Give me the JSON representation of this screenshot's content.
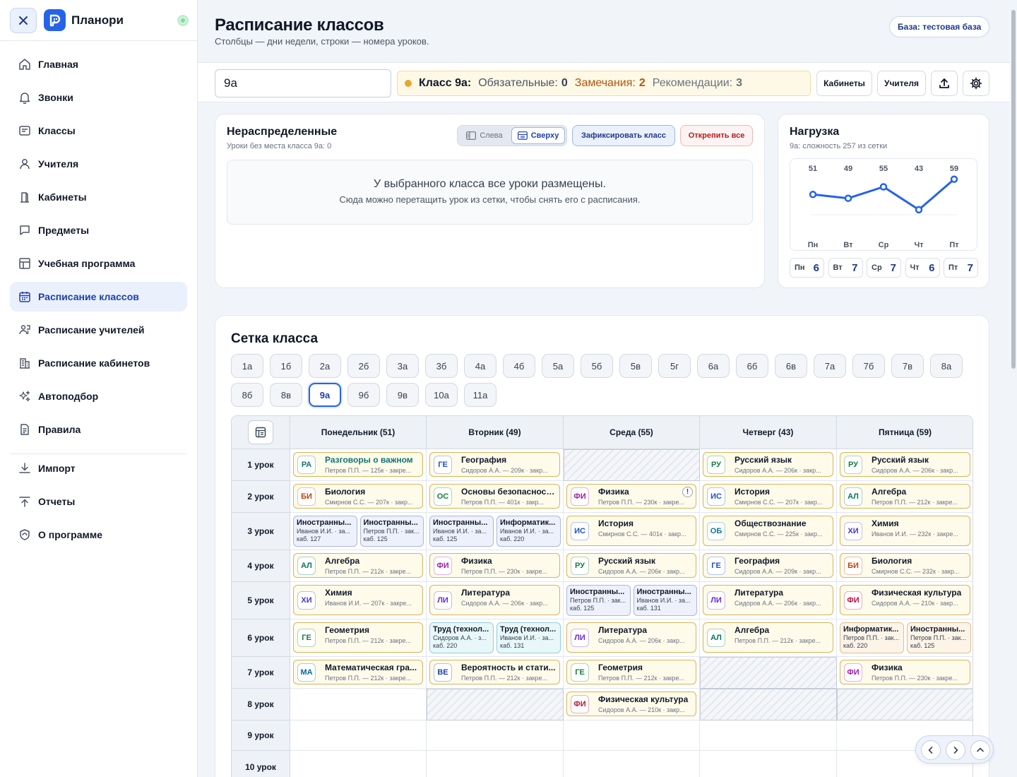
{
  "app": {
    "name": "Планори"
  },
  "nav": {
    "items": [
      {
        "label": "Главная",
        "icon": "home-icon"
      },
      {
        "label": "Звонки",
        "icon": "bell-icon"
      },
      {
        "label": "Классы",
        "icon": "card-icon"
      },
      {
        "label": "Учителя",
        "icon": "user-icon"
      },
      {
        "label": "Кабинеты",
        "icon": "door-icon"
      },
      {
        "label": "Предметы",
        "icon": "chat-icon"
      },
      {
        "label": "Учебная программа",
        "icon": "table-icon"
      },
      {
        "label": "Расписание классов",
        "icon": "calendar-icon",
        "active": true
      },
      {
        "label": "Расписание учителей",
        "icon": "teachers-icon"
      },
      {
        "label": "Расписание кабинетов",
        "icon": "building-icon"
      },
      {
        "label": "Автоподбор",
        "icon": "sparkles-icon"
      },
      {
        "label": "Правила",
        "icon": "document-icon"
      }
    ],
    "bottom": [
      {
        "label": "Импорт",
        "icon": "download-icon"
      },
      {
        "label": "Отчеты",
        "icon": "upload-icon"
      },
      {
        "label": "О программе",
        "icon": "shield-icon"
      }
    ]
  },
  "page": {
    "title": "Расписание классов",
    "subtitle": "Столбцы — дни недели, строки — номера уроков.",
    "db_badge": "База: тестовая база"
  },
  "toolbar": {
    "class_value": "9а",
    "status": {
      "class_label": "Класс 9а:",
      "required_label": "Обязательные:",
      "required_count": "0",
      "warnings_label": "Замечания:",
      "warnings_count": "2",
      "recs_label": "Рекомендации:",
      "recs_count": "3"
    },
    "rooms_button": "Кабинеты",
    "teachers_button": "Учителя"
  },
  "unassigned": {
    "title": "Нераспределенные",
    "subtitle": "Уроки без места класса 9а: 0",
    "toggle_left": "Слева",
    "toggle_top": "Сверху",
    "fix_button": "Зафиксировать класс",
    "unpin_button": "Открепить все",
    "empty_title": "У выбранного класса все уроки размещены.",
    "empty_hint": "Сюда можно перетащить урок из сетки, чтобы снять его с расписания."
  },
  "load": {
    "title": "Нагрузка",
    "subtitle": "9а: сложность 257 из сетки",
    "days": [
      {
        "short": "Пн",
        "count": "6"
      },
      {
        "short": "Вт",
        "count": "7"
      },
      {
        "short": "Ср",
        "count": "7"
      },
      {
        "short": "Чт",
        "count": "6"
      },
      {
        "short": "Пт",
        "count": "7"
      }
    ]
  },
  "chart_data": {
    "type": "line",
    "categories": [
      "Пн",
      "Вт",
      "Ср",
      "Чт",
      "Пт"
    ],
    "values": [
      51,
      49,
      55,
      43,
      59
    ],
    "ylim": [
      0,
      70
    ],
    "grid": true,
    "accent": "#2563eb"
  },
  "grid": {
    "title": "Сетка класса",
    "classes": [
      "1а",
      "1б",
      "2а",
      "2б",
      "3а",
      "3б",
      "4а",
      "4б",
      "5а",
      "5б",
      "5в",
      "5г",
      "6а",
      "6б",
      "6в",
      "7а",
      "7б",
      "7в",
      "8а",
      "8б",
      "8в",
      "9а",
      "9б",
      "9в",
      "10а",
      "11а"
    ],
    "selected_class": "9а",
    "days": [
      "Понедельник (51)",
      "Вторник (49)",
      "Среда (55)",
      "Четверг (43)",
      "Пятница (59)"
    ],
    "periods": [
      "1 урок",
      "2 урок",
      "3 урок",
      "4 урок",
      "5 урок",
      "6 урок",
      "7 урок",
      "8 урок",
      "9 урок",
      "10 урок"
    ],
    "cells": [
      [
        {
          "t": "lesson",
          "ab": "РА",
          "name": "Разговоры о важном",
          "detail": "Петров П.П. — 125к · закре...",
          "color": "#0f766e",
          "namecolor": "#0f766e"
        },
        {
          "t": "lesson",
          "ab": "ГЕ",
          "name": "География",
          "detail": "Сидоров А.А. — 209к · закр...",
          "color": "#1d4ed8"
        },
        {
          "t": "blocked"
        },
        {
          "t": "lesson",
          "ab": "РУ",
          "name": "Русский язык",
          "detail": "Сидоров А.А. — 206к · закр...",
          "color": "#15803d"
        },
        {
          "t": "lesson",
          "ab": "РУ",
          "name": "Русский язык",
          "detail": "Сидоров А.А. — 206к · закр...",
          "color": "#15803d"
        }
      ],
      [
        {
          "t": "lesson",
          "ab": "БИ",
          "name": "Биология",
          "detail": "Смирнов С.С. — 207к · закр...",
          "color": "#c2410c"
        },
        {
          "t": "lesson",
          "ab": "ОС",
          "name": "Основы безопасност...",
          "detail": "Петров П.П. — 401к · закр...",
          "color": "#15803d"
        },
        {
          "t": "lesson",
          "ab": "ФИ",
          "name": "Физика",
          "detail": "Петров П.П. — 230к · закре...",
          "color": "#a21caf",
          "warn": "!"
        },
        {
          "t": "lesson",
          "ab": "ИС",
          "name": "История",
          "detail": "Смирнов С.С. — 207к · закр...",
          "color": "#1d4ed8"
        },
        {
          "t": "lesson",
          "ab": "АЛ",
          "name": "Алгебра",
          "detail": "Петров П.П. — 212к · закре...",
          "color": "#047857"
        }
      ],
      [
        {
          "t": "split",
          "style": "",
          "parts": [
            {
              "name": "Иностранны...",
              "detail": "Иванов И.И. · за...",
              "room": "каб. 127"
            },
            {
              "name": "Иностранны...",
              "detail": "Петров П.П. · зак...",
              "room": "каб. 125"
            }
          ]
        },
        {
          "t": "split",
          "style": "",
          "parts": [
            {
              "name": "Иностранны...",
              "detail": "Иванов И.И. · за...",
              "room": "каб. 125"
            },
            {
              "name": "Информатик...",
              "detail": "Иванов И.И. · за...",
              "room": "каб. 220"
            }
          ]
        },
        {
          "t": "lesson",
          "ab": "ИС",
          "name": "История",
          "detail": "Смирнов С.С. — 401к · закр...",
          "color": "#1d4ed8"
        },
        {
          "t": "lesson",
          "ab": "ОБ",
          "name": "Обществознание",
          "detail": "Смирнов С.С. — 225к · закр...",
          "color": "#0e7490"
        },
        {
          "t": "lesson",
          "ab": "ХИ",
          "name": "Химия",
          "detail": "Иванов И.И. — 232к · закре...",
          "color": "#4338ca"
        }
      ],
      [
        {
          "t": "lesson",
          "ab": "АЛ",
          "name": "Алгебра",
          "detail": "Петров П.П. — 212к · закре...",
          "color": "#047857"
        },
        {
          "t": "lesson",
          "ab": "ФИ",
          "name": "Физика",
          "detail": "Петров П.П. — 230к · закре...",
          "color": "#a21caf"
        },
        {
          "t": "lesson",
          "ab": "РУ",
          "name": "Русский язык",
          "detail": "Сидоров А.А. — 206к · закр...",
          "color": "#15803d"
        },
        {
          "t": "lesson",
          "ab": "ГЕ",
          "name": "География",
          "detail": "Сидоров А.А. — 209к · закр...",
          "color": "#1d4ed8"
        },
        {
          "t": "lesson",
          "ab": "БИ",
          "name": "Биология",
          "detail": "Смирнов С.С. — 232к · закр...",
          "color": "#c2410c"
        }
      ],
      [
        {
          "t": "lesson",
          "ab": "ХИ",
          "name": "Химия",
          "detail": "Иванов И.И. — 207к · закре...",
          "color": "#4338ca"
        },
        {
          "t": "lesson",
          "ab": "ЛИ",
          "name": "Литература",
          "detail": "Сидоров А.А. — 206к · закр...",
          "color": "#6d28d9"
        },
        {
          "t": "split",
          "style": "",
          "parts": [
            {
              "name": "Иностранны...",
              "detail": "Петров П.П. · зак...",
              "room": "каб. 125"
            },
            {
              "name": "Иностранны...",
              "detail": "Иванов И.И. · за...",
              "room": "каб. 131"
            }
          ]
        },
        {
          "t": "lesson",
          "ab": "ЛИ",
          "name": "Литература",
          "detail": "Сидоров А.А. — 206к · закр...",
          "color": "#6d28d9"
        },
        {
          "t": "lesson",
          "ab": "ФИ",
          "name": "Физическая культура",
          "detail": "Сидоров А.А. — 210к · закр...",
          "color": "#be123c"
        }
      ],
      [
        {
          "t": "lesson",
          "ab": "ГЕ",
          "name": "Геометрия",
          "detail": "Петров П.П. — 212к · закре...",
          "color": "#15803d"
        },
        {
          "t": "split",
          "style": "teal",
          "parts": [
            {
              "name": "Труд (технол...",
              "detail": "Сидоров А.А. · з...",
              "room": "каб. 220"
            },
            {
              "name": "Труд (технол...",
              "detail": "Иванов И.И. · за...",
              "room": "каб. 131"
            }
          ]
        },
        {
          "t": "lesson",
          "ab": "ЛИ",
          "name": "Литература",
          "detail": "Сидоров А.А. — 206к · закр...",
          "color": "#6d28d9"
        },
        {
          "t": "lesson",
          "ab": "АЛ",
          "name": "Алгебра",
          "detail": "Петров П.П. — 212к · закре...",
          "color": "#047857"
        },
        {
          "t": "split",
          "style": "orange",
          "parts": [
            {
              "name": "Информатик...",
              "detail": "Петров П.П. · зак...",
              "room": "каб. 220"
            },
            {
              "name": "Иностранны...",
              "detail": "Петров П.П. · зак...",
              "room": "каб. 125"
            }
          ]
        }
      ],
      [
        {
          "t": "lesson",
          "ab": "МА",
          "name": "Математическая гра...",
          "detail": "Петров П.П. — 212к · закре...",
          "color": "#0369a1"
        },
        {
          "t": "lesson",
          "ab": "ВЕ",
          "name": "Вероятность и стати...",
          "detail": "Петров П.П. — 212к · закре...",
          "color": "#1e40af"
        },
        {
          "t": "lesson",
          "ab": "ГЕ",
          "name": "Геометрия",
          "detail": "Петров П.П. — 212к · закре...",
          "color": "#15803d"
        },
        {
          "t": "blocked"
        },
        {
          "t": "lesson",
          "ab": "ФИ",
          "name": "Физика",
          "detail": "Петров П.П. — 230к · закре...",
          "color": "#a21caf"
        }
      ],
      [
        {
          "t": "empty"
        },
        {
          "t": "blocked"
        },
        {
          "t": "lesson",
          "ab": "ФИ",
          "name": "Физическая культура",
          "detail": "Сидоров А.А. — 210к · закр...",
          "color": "#be123c"
        },
        {
          "t": "blocked"
        },
        {
          "t": "blocked"
        }
      ],
      [
        {
          "t": "empty"
        },
        {
          "t": "empty"
        },
        {
          "t": "empty"
        },
        {
          "t": "empty"
        },
        {
          "t": "empty"
        }
      ],
      [
        {
          "t": "empty"
        },
        {
          "t": "empty"
        },
        {
          "t": "empty"
        },
        {
          "t": "empty"
        },
        {
          "t": "empty"
        }
      ]
    ]
  }
}
